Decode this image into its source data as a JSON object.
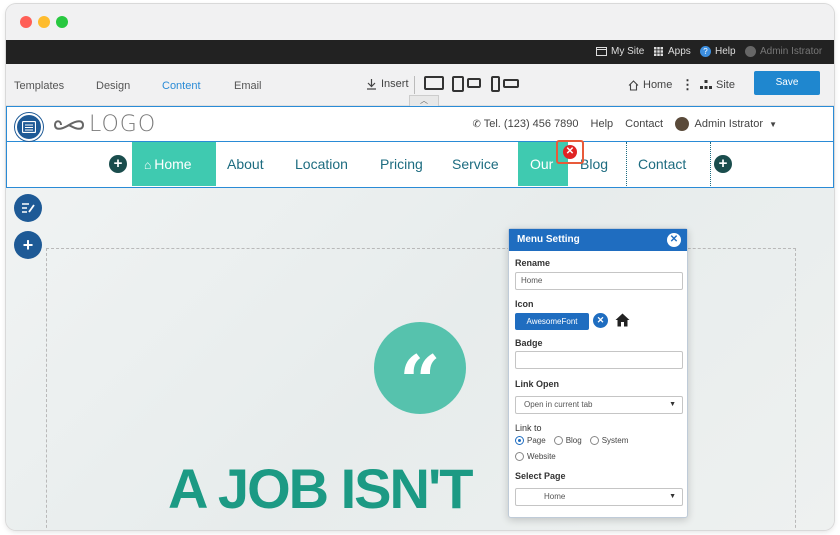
{
  "window": {
    "controls": [
      "close",
      "minimize",
      "maximize"
    ]
  },
  "adminbar": {
    "my_site": "My Site",
    "apps": "Apps",
    "help": "Help",
    "user": "Admin Istrator"
  },
  "toolbar": {
    "tabs": [
      "Templates",
      "Design",
      "Content",
      "Email"
    ],
    "active_tab": "Content",
    "insert": "Insert",
    "home": "Home",
    "site": "Site",
    "save": "Save"
  },
  "header": {
    "logo": "LOGO",
    "tel": "Tel. (123) 456 7890",
    "help": "Help",
    "contact": "Contact",
    "user": "Admin Istrator"
  },
  "nav": {
    "items": [
      "Home",
      "About",
      "Location",
      "Pricing",
      "Service",
      "Our",
      "Blog",
      "Contact"
    ],
    "active": "Home"
  },
  "hero": {
    "quote_mark": "“",
    "title": "A JOB ISN'T"
  },
  "panel": {
    "title": "Menu Setting",
    "rename_label": "Rename",
    "rename_value": "Home",
    "icon_label": "Icon",
    "icon_button": "AwesomeFont",
    "badge_label": "Badge",
    "badge_value": "",
    "link_open_label": "Link Open",
    "link_open_value": "Open in current tab",
    "link_to_label": "Link to",
    "link_options": [
      "Page",
      "Blog",
      "System",
      "Website"
    ],
    "link_selected": "Page",
    "select_page_label": "Select Page",
    "select_page_value": "Home"
  },
  "colors": {
    "accent": "#3fcab0",
    "brand_blue": "#1f6dc0",
    "nav_text": "#1d6c80",
    "hero_text": "#1c9a84"
  }
}
